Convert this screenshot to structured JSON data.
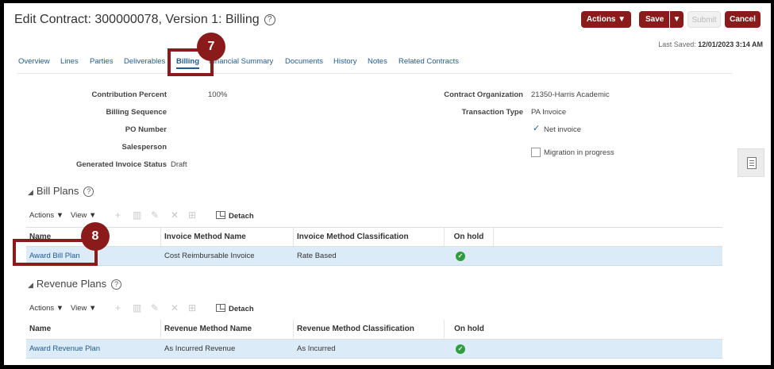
{
  "header": {
    "title": "Edit Contract: 300000078, Version 1: Billing",
    "help_glyph": "?",
    "actions_label": "Actions ▼",
    "save_label": "Save",
    "save_split": "▼",
    "submit_label": "Submit",
    "cancel_label": "Cancel",
    "last_saved_label": "Last Saved:",
    "last_saved_value": "12/01/2023 3:14 AM"
  },
  "tabs": [
    "Overview",
    "Lines",
    "Parties",
    "Deliverables",
    "Billing",
    "Financial Summary",
    "Documents",
    "History",
    "Notes",
    "Related Contracts"
  ],
  "active_tab": "Billing",
  "form": {
    "contribution_percent_label": "Contribution Percent",
    "contribution_percent_value": "100%",
    "billing_sequence_label": "Billing Sequence",
    "po_number_label": "PO Number",
    "salesperson_label": "Salesperson",
    "generated_invoice_status_label": "Generated Invoice Status",
    "generated_invoice_status_value": "Draft",
    "contract_org_label": "Contract Organization",
    "contract_org_value": "21350-Harris Academic",
    "transaction_type_label": "Transaction Type",
    "transaction_type_value": "PA Invoice",
    "net_invoice_check": "✓",
    "net_invoice_label": "Net invoice",
    "migration_label": "Migration in progress"
  },
  "bill_plans": {
    "title": "Bill Plans",
    "toggle": "◢",
    "toolbar": {
      "actions": "Actions ▼",
      "view": "View ▼",
      "detach": "Detach"
    },
    "columns": [
      "Name",
      "Invoice Method Name",
      "Invoice Method Classification",
      "On hold"
    ],
    "rows": [
      {
        "name": "Award Bill Plan",
        "method": "Cost Reimbursable Invoice",
        "classification": "Rate Based",
        "on_hold": "✓"
      }
    ]
  },
  "revenue_plans": {
    "title": "Revenue Plans",
    "toggle": "◢",
    "toolbar": {
      "actions": "Actions ▼",
      "view": "View ▼",
      "detach": "Detach"
    },
    "columns": [
      "Name",
      "Revenue Method Name",
      "Revenue Method Classification",
      "On hold"
    ],
    "rows": [
      {
        "name": "Award Revenue Plan",
        "method": "As Incurred Revenue",
        "classification": "As Incurred",
        "on_hold": "✓"
      }
    ]
  },
  "toolbar_icons": {
    "add": "+",
    "delete": "▥",
    "edit": "✎",
    "remove": "✕",
    "columns": "⊞"
  },
  "callouts": {
    "step7": "7",
    "step8": "8"
  },
  "colors": {
    "accent": "#8b1a1a",
    "link": "#1f5a96",
    "row_highlight": "#dcebf8",
    "ok_green": "#2e9d3d"
  }
}
